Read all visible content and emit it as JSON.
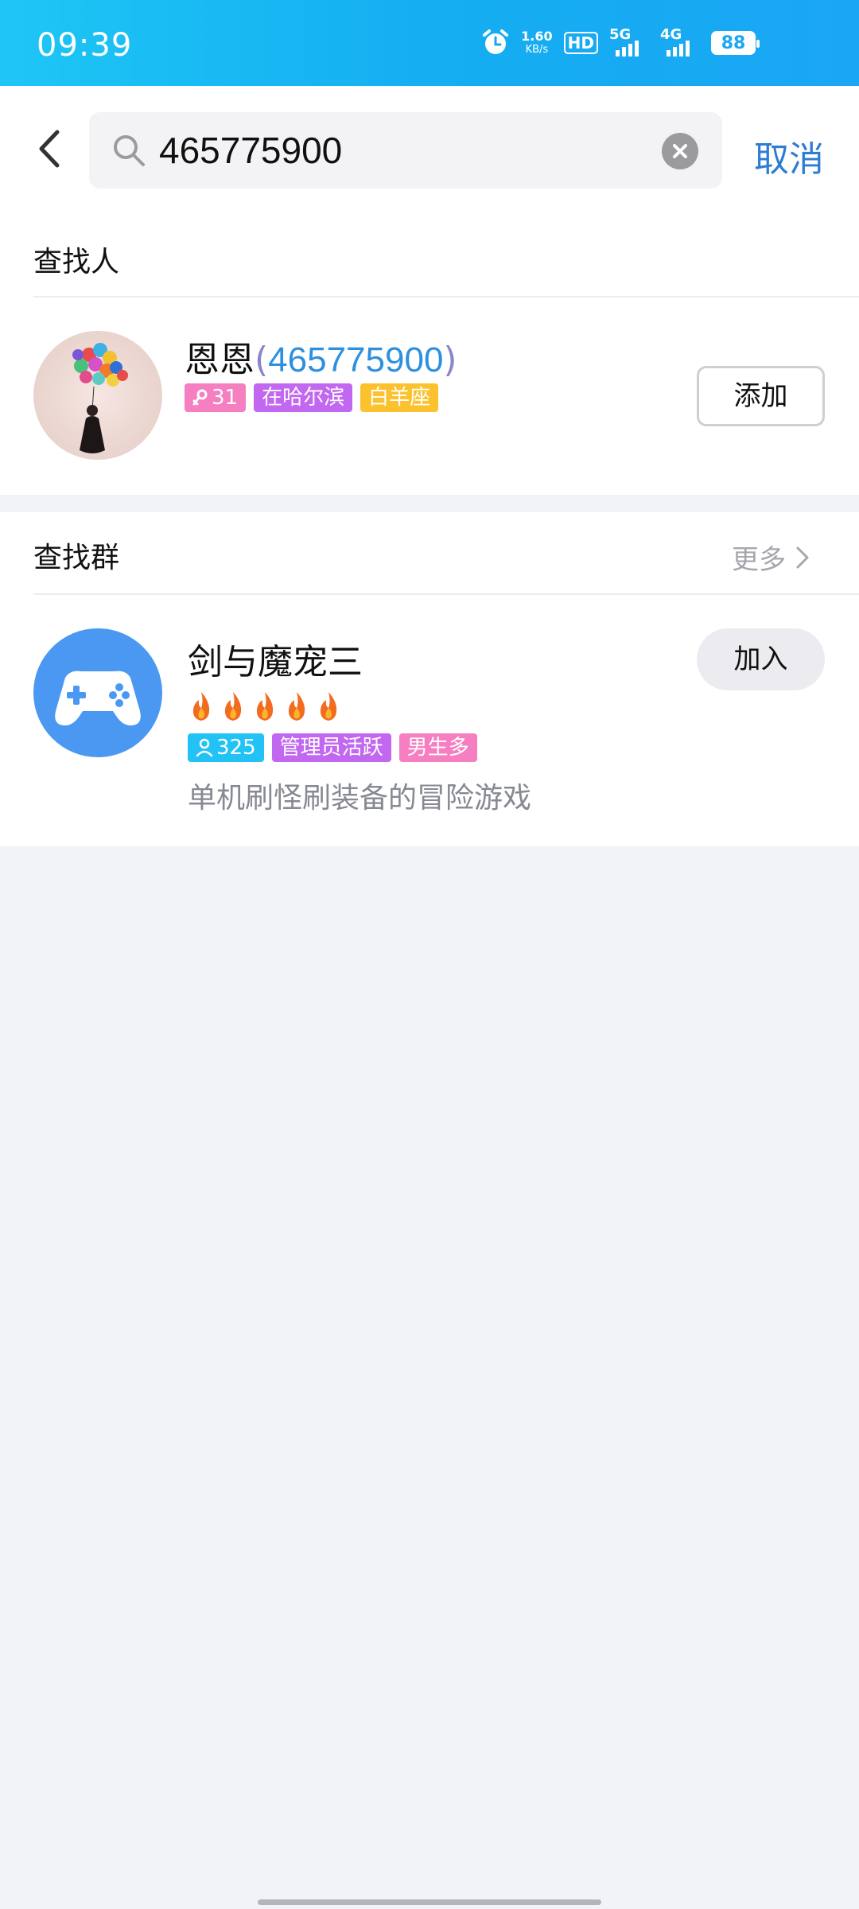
{
  "status_bar": {
    "time": "09:39",
    "net_speed_value": "1.60",
    "net_speed_unit": "KB/s",
    "hd_label": "HD",
    "sim1_label": "5G",
    "sim2_label": "4G",
    "battery": "88",
    "icons": [
      "alarm-icon",
      "hd-icon",
      "signal-5g-icon",
      "signal-4g-icon",
      "battery-icon"
    ]
  },
  "search": {
    "query": "465775900",
    "cancel_label": "取消",
    "icons": [
      "back-icon",
      "search-icon",
      "clear-icon"
    ]
  },
  "people_section": {
    "title": "查找人",
    "result": {
      "nickname": "恩恩",
      "open_paren": "(",
      "uid": "465775900",
      "close_paren": ")",
      "tags": [
        {
          "text": "31",
          "icon": "female-icon",
          "color": "#f57fc0"
        },
        {
          "text": "在哈尔滨",
          "color": "#c267f0"
        },
        {
          "text": "白羊座",
          "color": "#fbc22d"
        }
      ],
      "action_label": "添加"
    }
  },
  "group_section": {
    "title": "查找群",
    "more_label": "更多",
    "result": {
      "name": "剑与魔宠三",
      "heat_level": 5,
      "tags": [
        {
          "text": "325",
          "icon": "member-icon",
          "color": "#22c3f4"
        },
        {
          "text": "管理员活跃",
          "color": "#c267f0"
        },
        {
          "text": "男生多",
          "color": "#f57fc0"
        }
      ],
      "description": "单机刷怪刷装备的冒险游戏",
      "action_label": "加入"
    }
  },
  "colors": {
    "accent": "#2d7dd2",
    "status_bar": "#14aef2",
    "page_background": "#f2f3f7",
    "game_avatar": "#4a98f2"
  }
}
